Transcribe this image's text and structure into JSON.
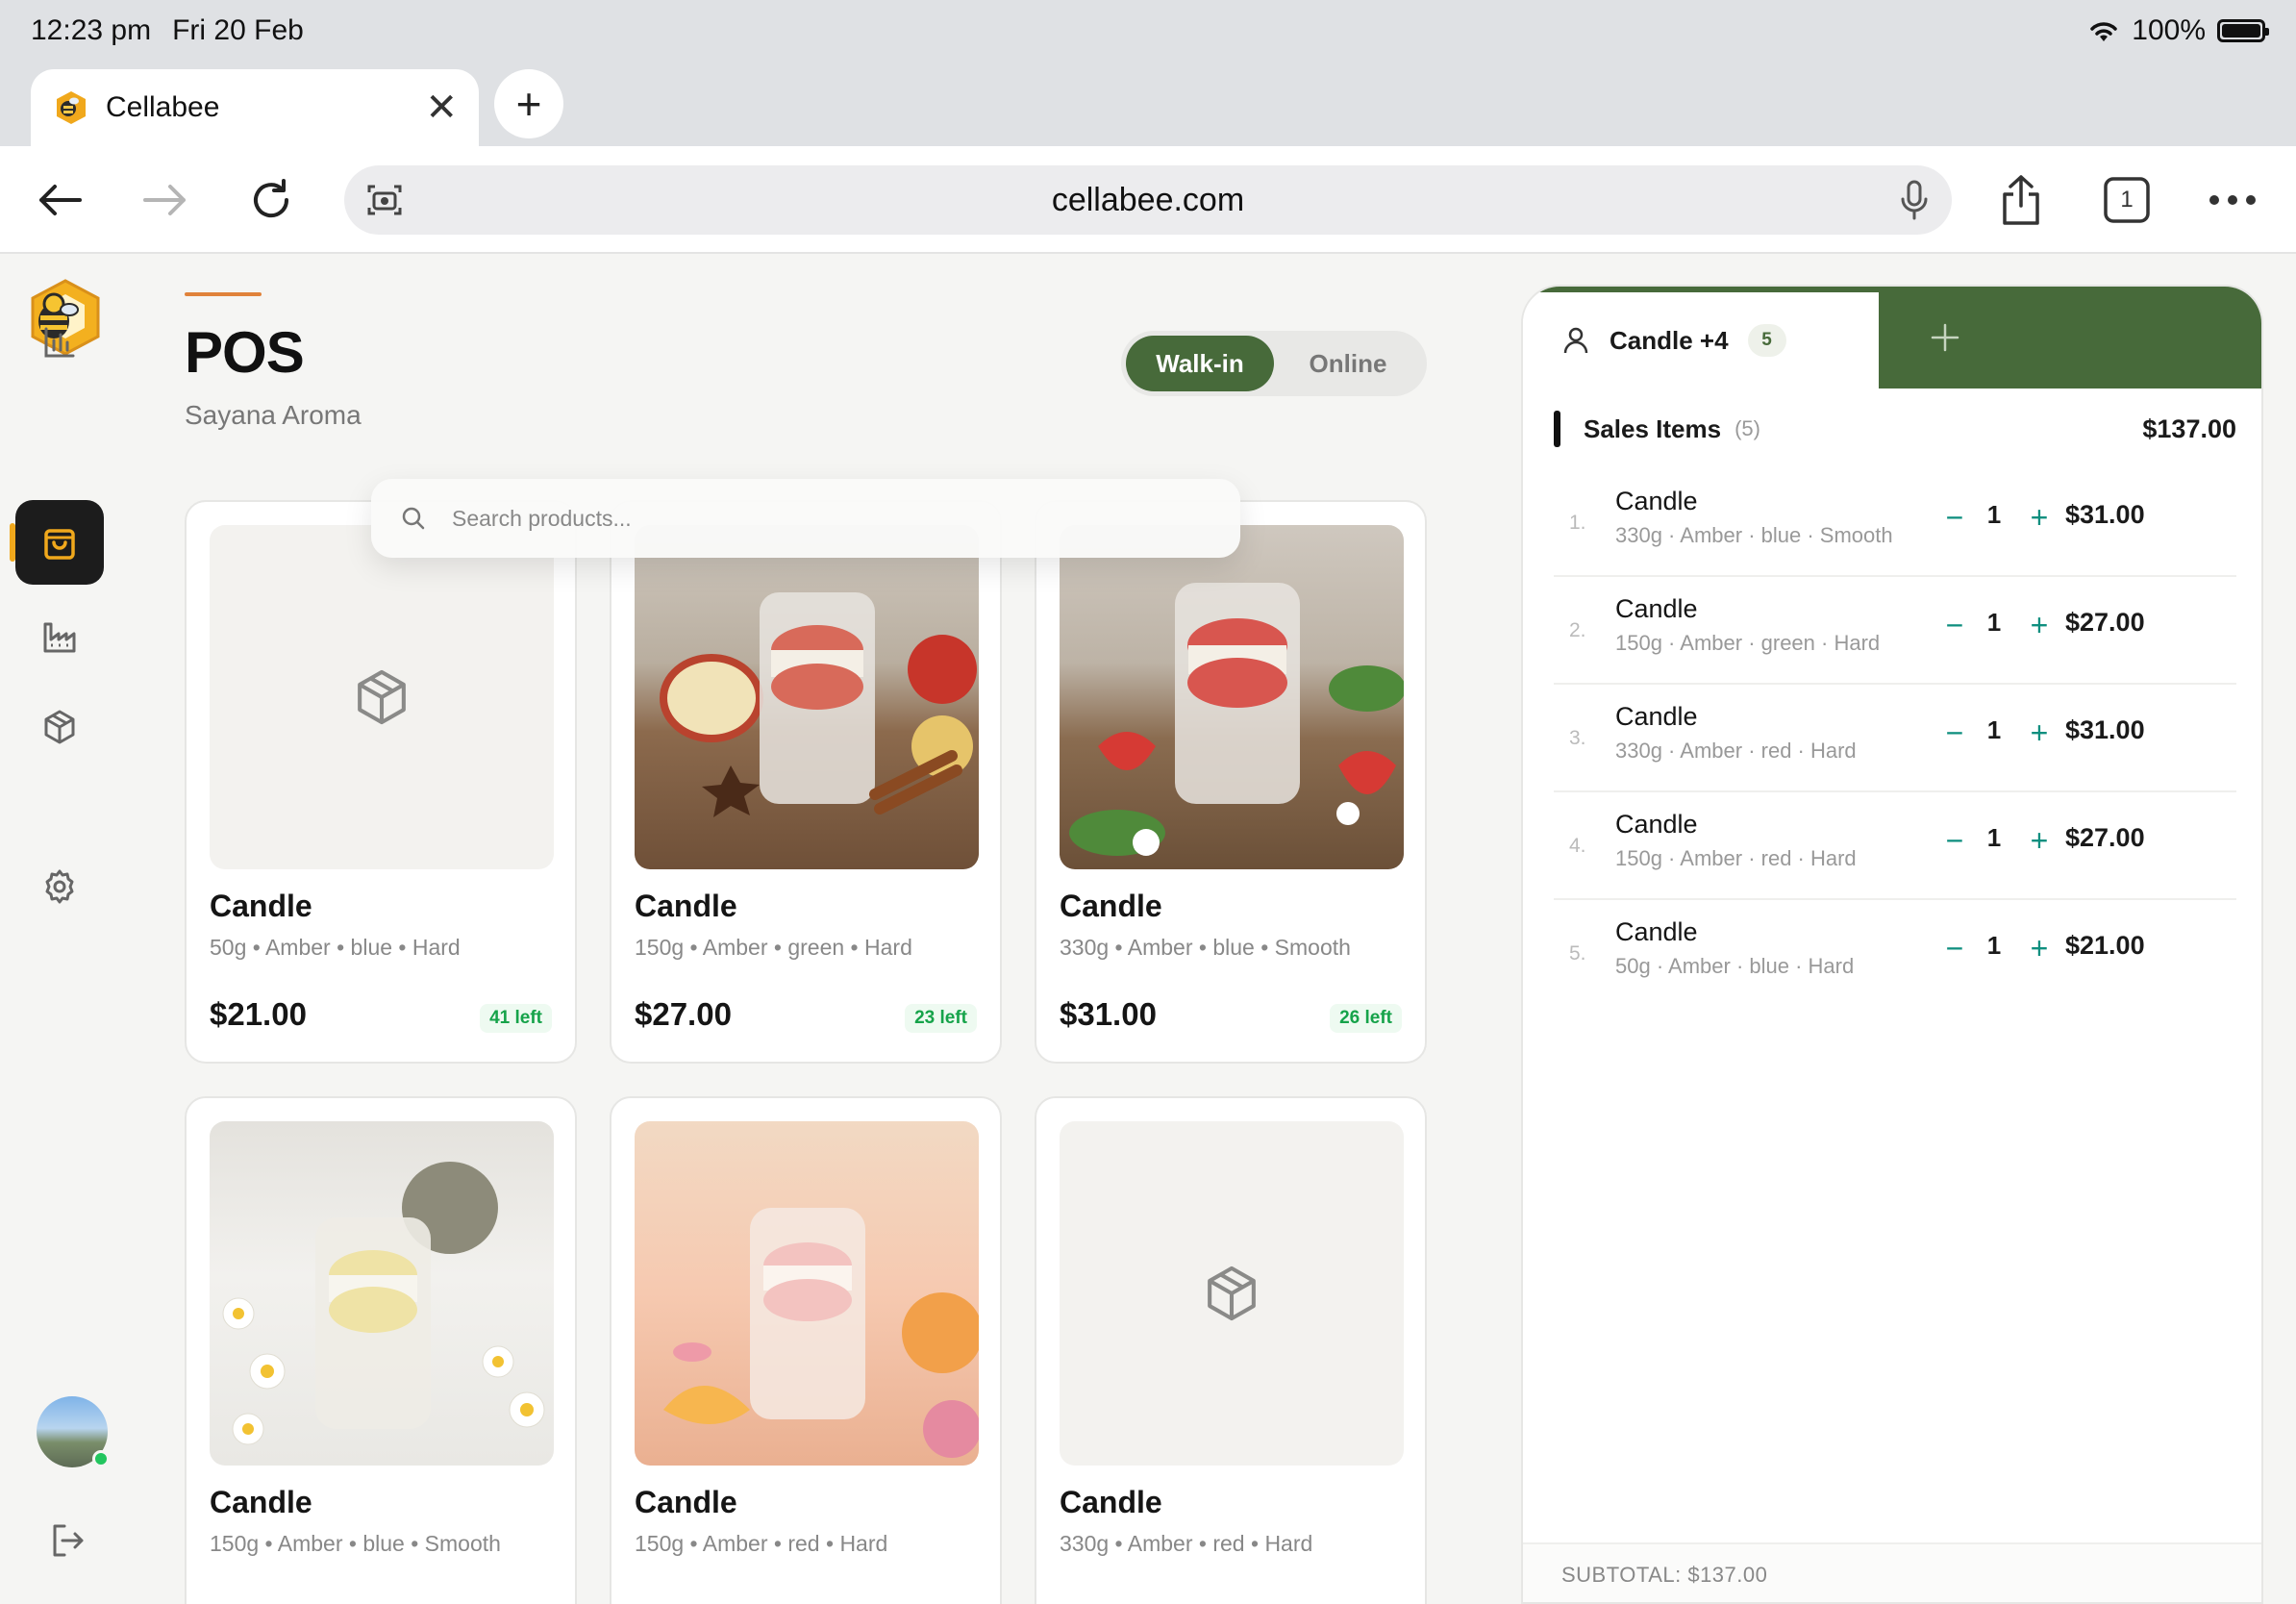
{
  "status_bar": {
    "time": "12:23 pm",
    "date": "Fri 20 Feb",
    "battery": "100%"
  },
  "browser": {
    "tab_title": "Cellabee",
    "new_tab_label": "+",
    "url": "cellabee.com",
    "tab_count": "1"
  },
  "sidebar": {
    "items": [
      {
        "name": "analytics",
        "icon": "bar-chart-icon",
        "active": false
      },
      {
        "name": "pos",
        "icon": "shopping-bag-icon",
        "active": true
      },
      {
        "name": "production",
        "icon": "factory-icon",
        "active": false
      },
      {
        "name": "products",
        "icon": "box-icon",
        "active": false
      },
      {
        "name": "settings",
        "icon": "gear-icon",
        "active": false
      }
    ],
    "logout_icon": "logout-icon",
    "accent_color": "#f0a81c"
  },
  "header": {
    "title": "POS",
    "subtitle": "Sayana Aroma",
    "modes": [
      "Walk-in",
      "Online"
    ],
    "active_mode": "Walk-in"
  },
  "search": {
    "placeholder": "Search products..."
  },
  "products": [
    {
      "name": "Candle",
      "weight": "50g",
      "scent": "Amber",
      "color": "blue",
      "finish": "Hard",
      "price": "$21.00",
      "stock": "41 left",
      "image": "placeholder-box"
    },
    {
      "name": "Candle",
      "weight": "150g",
      "scent": "Amber",
      "color": "green",
      "finish": "Hard",
      "price": "$27.00",
      "stock": "23 left",
      "image": "apple-cinnamon-candle"
    },
    {
      "name": "Candle",
      "weight": "330g",
      "scent": "Amber",
      "color": "blue",
      "finish": "Smooth",
      "price": "$31.00",
      "stock": "26 left",
      "image": "strawberry-candle"
    },
    {
      "name": "Candle",
      "weight": "150g",
      "scent": "Amber",
      "color": "blue",
      "finish": "Smooth",
      "price": "",
      "stock": "",
      "image": "chamomile-candle"
    },
    {
      "name": "Candle",
      "weight": "150g",
      "scent": "Amber",
      "color": "red",
      "finish": "Hard",
      "price": "",
      "stock": "",
      "image": "peach-rose-candle"
    },
    {
      "name": "Candle",
      "weight": "330g",
      "scent": "Amber",
      "color": "red",
      "finish": "Hard",
      "price": "",
      "stock": "",
      "image": "placeholder-box"
    }
  ],
  "cart": {
    "tab_label": "Candle +4",
    "tab_count": "5",
    "section_title": "Sales Items",
    "section_count": "(5)",
    "total": "$137.00",
    "items": [
      {
        "index": "1.",
        "name": "Candle",
        "details": "330g · Amber · blue · Smooth",
        "qty": "1",
        "amount": "$31.00"
      },
      {
        "index": "2.",
        "name": "Candle",
        "details": "150g · Amber · green · Hard",
        "qty": "1",
        "amount": "$27.00"
      },
      {
        "index": "3.",
        "name": "Candle",
        "details": "330g · Amber · red · Hard",
        "qty": "1",
        "amount": "$31.00"
      },
      {
        "index": "4.",
        "name": "Candle",
        "details": "150g · Amber · red · Hard",
        "qty": "1",
        "amount": "$27.00"
      },
      {
        "index": "5.",
        "name": "Candle",
        "details": "50g · Amber · blue · Hard",
        "qty": "1",
        "amount": "$21.00"
      }
    ],
    "minus_label": "−",
    "plus_label": "+",
    "subtotal": "SUBTOTAL: $137.00"
  },
  "colors": {
    "brand_green": "#476a3a",
    "stock_green": "#16a34a",
    "qty_teal": "#0f8f7f",
    "accent_orange": "#e0823a"
  }
}
